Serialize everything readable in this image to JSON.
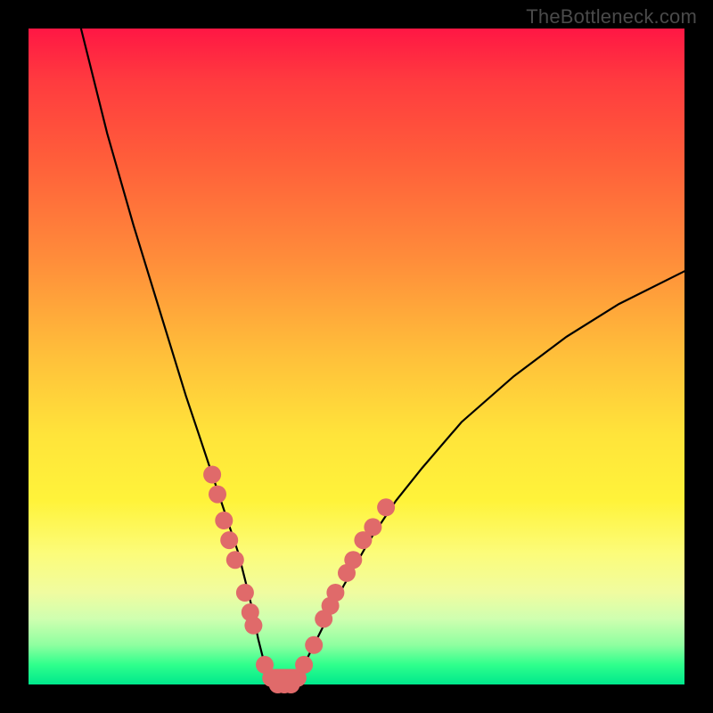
{
  "watermark": "TheBottleneck.com",
  "chart_data": {
    "type": "line",
    "title": "",
    "xlabel": "",
    "ylabel": "",
    "xlim": [
      0,
      100
    ],
    "ylim": [
      0,
      100
    ],
    "background_gradient": {
      "top": "#ff1744",
      "middle": "#ffe43a",
      "bottom": "#00e88c"
    },
    "series": [
      {
        "name": "bottleneck-curve",
        "x": [
          8,
          12,
          16,
          20,
          24,
          26,
          28,
          30,
          32,
          33,
          34,
          35,
          36,
          37,
          38,
          40,
          42,
          44,
          46,
          48,
          52,
          56,
          60,
          66,
          74,
          82,
          90,
          100
        ],
        "values": [
          100,
          84,
          70,
          57,
          44,
          38,
          32,
          26,
          20,
          16,
          12,
          7,
          3,
          1,
          0,
          0,
          3,
          7,
          11,
          15,
          22,
          28,
          33,
          40,
          47,
          53,
          58,
          63
        ]
      }
    ],
    "markers": {
      "name": "highlight-dots",
      "color": "#e06a6a",
      "points": [
        {
          "x": 28.0,
          "y": 32
        },
        {
          "x": 28.8,
          "y": 29
        },
        {
          "x": 29.8,
          "y": 25
        },
        {
          "x": 30.6,
          "y": 22
        },
        {
          "x": 31.5,
          "y": 19
        },
        {
          "x": 33.0,
          "y": 14
        },
        {
          "x": 33.8,
          "y": 11
        },
        {
          "x": 34.3,
          "y": 9
        },
        {
          "x": 36.0,
          "y": 3
        },
        {
          "x": 37.0,
          "y": 1
        },
        {
          "x": 38.0,
          "y": 0
        },
        {
          "x": 39.0,
          "y": 0
        },
        {
          "x": 40.0,
          "y": 0
        },
        {
          "x": 41.0,
          "y": 1
        },
        {
          "x": 42.0,
          "y": 3
        },
        {
          "x": 43.5,
          "y": 6
        },
        {
          "x": 45.0,
          "y": 10
        },
        {
          "x": 46.0,
          "y": 12
        },
        {
          "x": 46.8,
          "y": 14
        },
        {
          "x": 48.5,
          "y": 17
        },
        {
          "x": 49.5,
          "y": 19
        },
        {
          "x": 51.0,
          "y": 22
        },
        {
          "x": 52.5,
          "y": 24
        },
        {
          "x": 54.5,
          "y": 27
        }
      ]
    }
  }
}
